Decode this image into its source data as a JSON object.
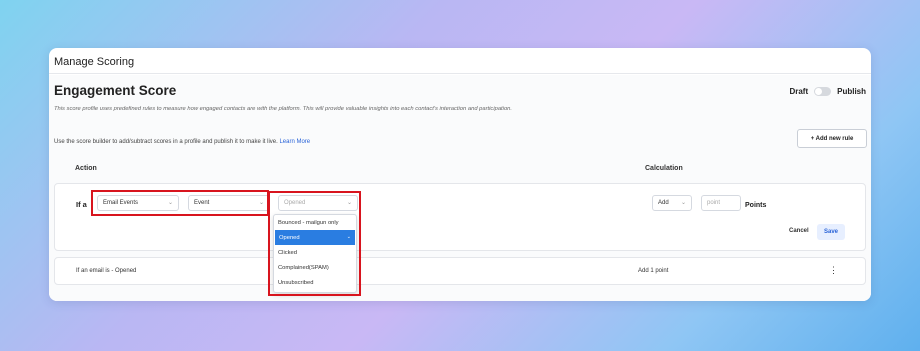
{
  "window": {
    "title": "Manage Scoring"
  },
  "page": {
    "title": "Engagement Score",
    "description": "This score profile uses predefined rules to measure how engaged contacts are with the platform. This will provide valuable insights into each contact's interaction and participation.",
    "builder_note": "Use the score builder to add/subtract scores in a profile and publish it to make it live.",
    "learn_more": "Learn More",
    "draft_label": "Draft",
    "publish_label": "Publish",
    "add_rule_label": "+ Add new rule"
  },
  "columns": {
    "action": "Action",
    "calculation": "Calculation"
  },
  "rule_editor": {
    "if_label": "If a",
    "category_value": "Email Events",
    "event_value": "Event",
    "status_placeholder": "Opened",
    "operation_value": "Add",
    "points_placeholder": "point",
    "points_label": "Points",
    "cancel_label": "Cancel",
    "save_label": "Save"
  },
  "dropdown": {
    "options": [
      "Bounced - mailgun only",
      "Opened",
      "Clicked",
      "Complained(SPAM)",
      "Unsubscribed"
    ],
    "selected": "Opened"
  },
  "rules": [
    {
      "rule": "If an email is - Opened",
      "calculation": "Add 1 point"
    }
  ],
  "colors": {
    "highlight": "#d8141e",
    "accent": "#2a7de1",
    "link": "#2a64d8"
  }
}
